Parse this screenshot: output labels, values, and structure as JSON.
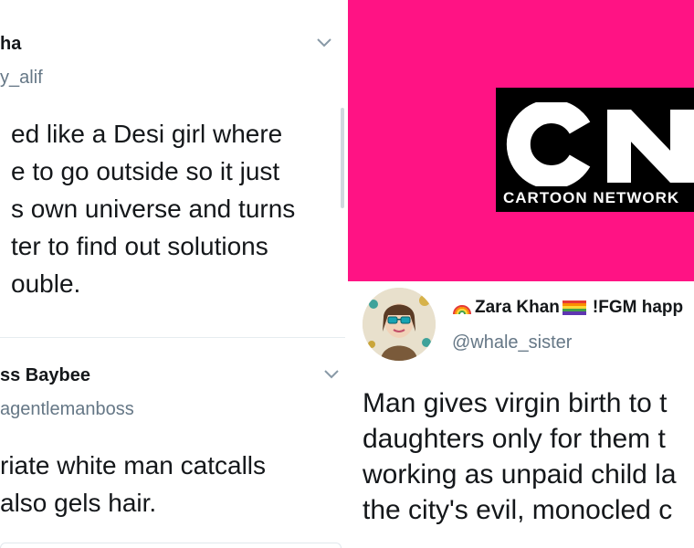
{
  "left": {
    "tweets": [
      {
        "name": "ha",
        "handle": "y_alif",
        "lines": [
          "ed like a Desi girl where",
          "e to go outside so it just",
          "s own universe and turns",
          "ter to find out solutions",
          "ouble."
        ]
      },
      {
        "name": "ss Baybee",
        "handle": "agentlemanboss",
        "lines": [
          "riate white man catcalls",
          "also gels hair."
        ]
      }
    ]
  },
  "right": {
    "banner": {
      "background_color": "#ff1384",
      "logo_letters": "CN",
      "logo_text": "CARTOON NETWORK"
    },
    "tweet": {
      "name_prefix": "",
      "name": "Zara Khan",
      "name_suffix": "!FGM happ",
      "handle": "@whale_sister",
      "lines": [
        "Man gives virgin birth to t",
        "daughters only for them t",
        "working as unpaid child la",
        "the city's evil, monocled c"
      ]
    }
  },
  "icons": [
    "chevron-down-icon",
    "rainbow-emoji-icon",
    "rainbow-flag-icon",
    "avatar-image"
  ]
}
